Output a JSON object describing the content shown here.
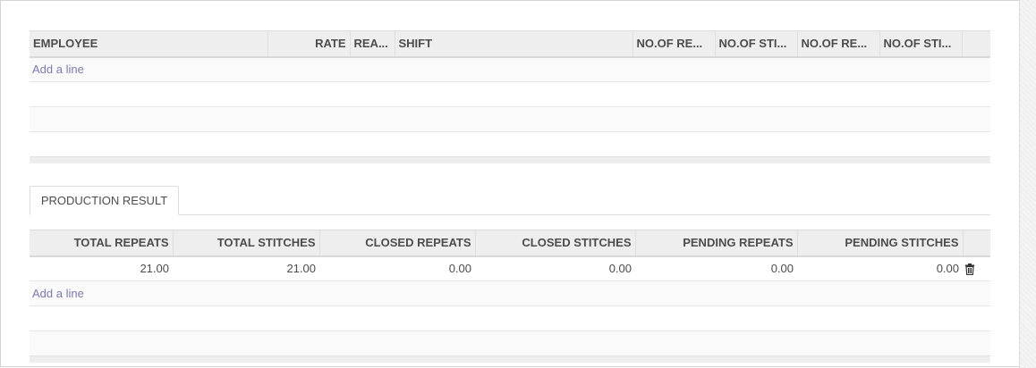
{
  "employee_table": {
    "columns": [
      {
        "label": "EMPLOYEE",
        "align": "left"
      },
      {
        "label": "RATE",
        "align": "right"
      },
      {
        "label": "REA...",
        "align": "left"
      },
      {
        "label": "SHIFT",
        "align": "left"
      },
      {
        "label": "NO.OF RE...",
        "align": "left"
      },
      {
        "label": "NO.OF STI...",
        "align": "left"
      },
      {
        "label": "NO.OF RE...",
        "align": "left"
      },
      {
        "label": "NO.OF STI...",
        "align": "left"
      }
    ],
    "add_line_label": "Add a line"
  },
  "tabs": [
    {
      "label": "PRODUCTION RESULT",
      "active": true
    }
  ],
  "result_table": {
    "columns": [
      "TOTAL REPEATS",
      "TOTAL STITCHES",
      "CLOSED REPEATS",
      "CLOSED STITCHES",
      "PENDING REPEATS",
      "PENDING STITCHES"
    ],
    "rows": [
      {
        "total_repeats": "21.00",
        "total_stitches": "21.00",
        "closed_repeats": "0.00",
        "closed_stitches": "0.00",
        "pending_repeats": "0.00",
        "pending_stitches": "0.00",
        "delete_icon": "trash-icon"
      }
    ],
    "add_line_label": "Add a line"
  },
  "colors": {
    "link": "#7c7bad",
    "header_bg": "#eeeeee",
    "text": "#4c4c4c"
  }
}
